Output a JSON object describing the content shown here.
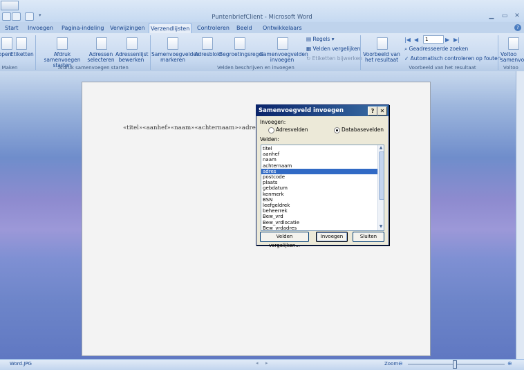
{
  "window": {
    "title": "PuntenbriefClient - Microsoft Word"
  },
  "tabs": [
    "Start",
    "Invoegen",
    "Pagina-indeling",
    "Verwijzingen",
    "Verzendlijsten",
    "Controleren",
    "Beeld",
    "Ontwikkelaars"
  ],
  "active_tab": "Verzendlijsten",
  "ribbon": {
    "groups": {
      "maken": "Maken",
      "afdruk": "Afdruk samenvoegen starten",
      "velden": "Velden beschrijven en invoegen",
      "voorbeeld": "Voorbeeld van het resultaat",
      "voltooien": "Voltoo"
    },
    "buttons": {
      "enveloppen": "open",
      "etiketten": "Etiketten",
      "afdruk_start_1": "Afdruk samenvoegen",
      "afdruk_start_2": "starten",
      "adressen_sel_1": "Adressen",
      "adressen_sel_2": "selecteren",
      "adressenlijst_1": "Adressenlijst",
      "adressenlijst_2": "bewerken",
      "samenvoeg_markeren_1": "Samenvoegvelden",
      "samenvoeg_markeren_2": "markeren",
      "adresblok": "Adresblok",
      "begroetingsregel": "Begroetingsregel",
      "samenvoeg_invoegen_1": "Samenvoegvelden",
      "samenvoeg_invoegen_2": "invoegen",
      "regels": "Regels",
      "velden_vergelijken": "Velden vergelijken",
      "etiketten_bijwerken": "Etiketten bijwerken",
      "voorbeeld_1": "Voorbeeld van",
      "voorbeeld_2": "het resultaat",
      "record_value": "1",
      "geadresseerde_zoeken": "Geadresseerde zoeken",
      "auto_controleren": "Automatisch controleren op fouten",
      "voltooien_1": "Voltoo",
      "voltooien_2": "samenvo"
    }
  },
  "document": {
    "fields_line": "«titel»«aanhef»«naam»«achternaam»«adres»"
  },
  "dialog": {
    "title": "Samenvoegveld invoegen",
    "insert_label": "Invoegen:",
    "radio_adresvelden": "Adresvelden",
    "radio_databasevelden": "Databasevelden",
    "selected_radio": "Databasevelden",
    "fields_label": "Velden:",
    "fields": [
      "titel",
      "aanhef",
      "naam",
      "achternaam",
      "adres",
      "postcode",
      "plaats",
      "gebdatum",
      "kenmerk",
      "BSN",
      "leefgeldrek",
      "beheerrek",
      "Bew_vrd",
      "Bew_vrdlocatie",
      "Bew_vrdadres"
    ],
    "selected_field": "adres",
    "btn_velden_vergelijken": "Velden vergelijken...",
    "btn_invoegen": "Invoegen",
    "btn_sluiten": "Sluiten"
  },
  "statusbar": {
    "file": "Word.JPG",
    "zoom_label": "Zoom:",
    "zoom_fraction": 0.48
  },
  "colors": {
    "titlebar": "#c5d9f1",
    "dialog_title": "#0a246a",
    "selection": "#316ac5"
  }
}
